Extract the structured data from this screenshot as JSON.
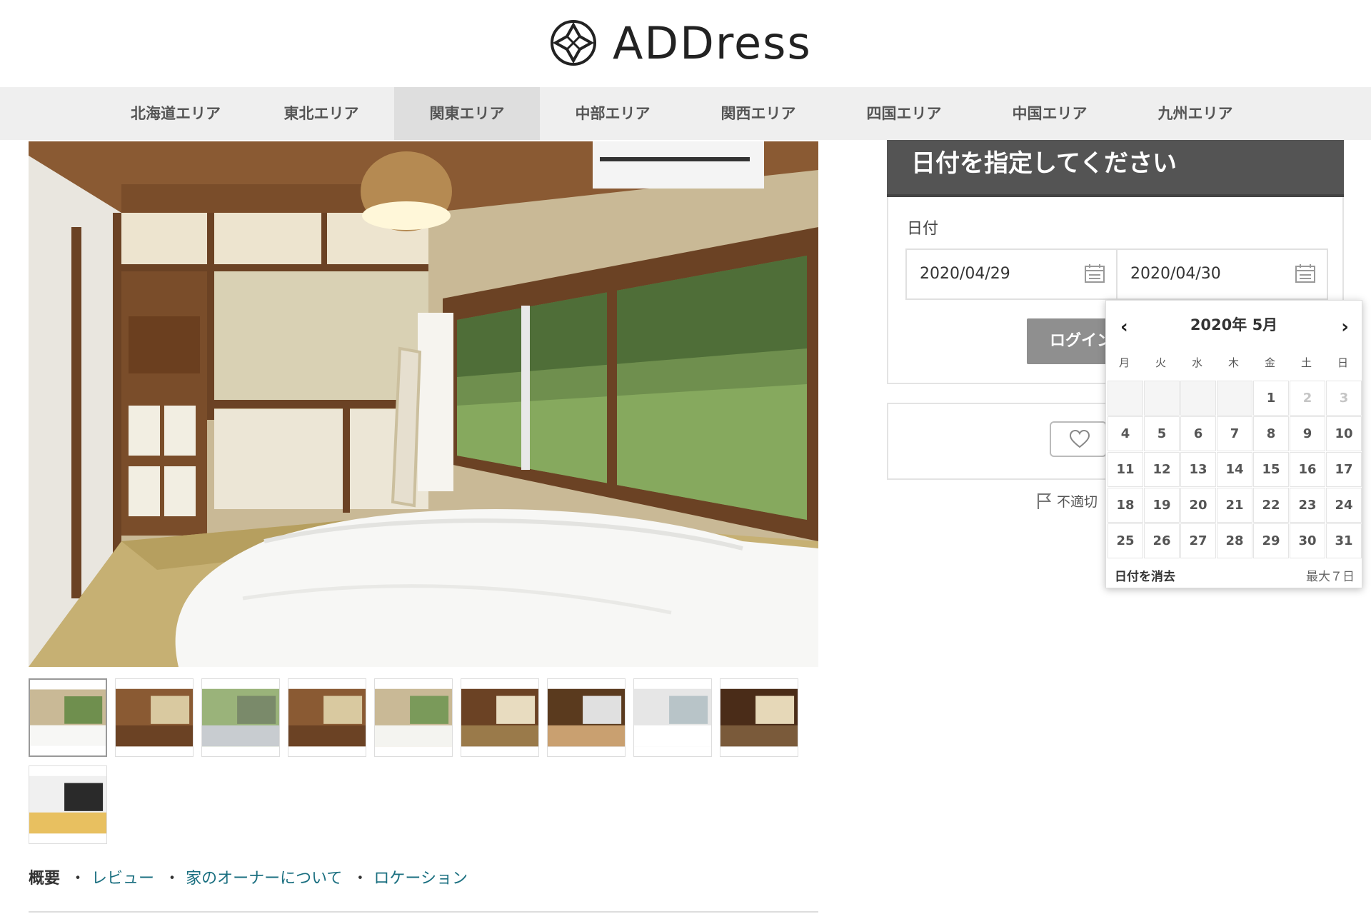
{
  "header": {
    "logo_text": "ADDress",
    "nav": [
      {
        "label": "北海道エリア"
      },
      {
        "label": "東北エリア"
      },
      {
        "label": "関東エリア",
        "active": true
      },
      {
        "label": "中部エリア"
      },
      {
        "label": "関西エリア"
      },
      {
        "label": "四国エリア"
      },
      {
        "label": "中国エリア"
      },
      {
        "label": "九州エリア"
      }
    ]
  },
  "gallery": {
    "thumbnail_count": 10,
    "active_index": 0
  },
  "page_links": {
    "overview": "概要",
    "review": "レビュー",
    "owner": "家のオーナーについて",
    "location": "ロケーション",
    "bullet": "・"
  },
  "booking": {
    "heading": "日付を指定してください",
    "date_label": "日付",
    "start_date": "2020/04/29",
    "end_date": "2020/04/30",
    "login_label": "ログイン"
  },
  "report_label": "不適切",
  "datepicker": {
    "title": "2020年 5月",
    "prev": "‹",
    "next": "›",
    "weekdays": [
      "月",
      "火",
      "水",
      "木",
      "金",
      "土",
      "日"
    ],
    "weeks": [
      [
        "",
        "",
        "",
        "",
        "1",
        "2",
        "3"
      ],
      [
        "4",
        "5",
        "6",
        "7",
        "8",
        "9",
        "10"
      ],
      [
        "11",
        "12",
        "13",
        "14",
        "15",
        "16",
        "17"
      ],
      [
        "18",
        "19",
        "20",
        "21",
        "22",
        "23",
        "24"
      ],
      [
        "25",
        "26",
        "27",
        "28",
        "29",
        "30",
        "31"
      ]
    ],
    "muted_days": [
      "2",
      "3"
    ],
    "clear_label": "日付を消去",
    "max_label": "最大７日"
  }
}
